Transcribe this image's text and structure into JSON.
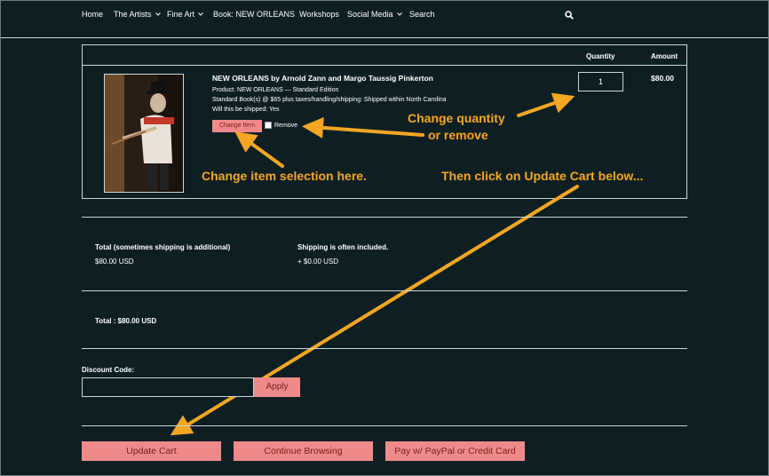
{
  "nav": {
    "home": "Home",
    "artists": "The Artists",
    "fine_art": "Fine Art",
    "book": "Book: NEW ORLEANS",
    "workshops": "Workshops",
    "social": "Social Media",
    "search": "Search"
  },
  "cart": {
    "col_quantity": "Quantity",
    "col_amount": "Amount",
    "product_title": "NEW ORLEANS by Arnold Zann and Margo Taussig Pinkerton",
    "product_line": "Product: NEW ORLEANS — Standard Edition",
    "product_detail": "Standard Book(s) @ $65 plus taxes/handling/shipping: Shipped within North Carolina",
    "shipped": "Will this be shipped: Yes",
    "change_item": "Change Item",
    "remove": "Remove",
    "quantity": "1",
    "amount": "$80.00"
  },
  "annotations": {
    "change_qty_1": "Change quantity",
    "change_qty_2": "or remove",
    "change_item": "Change item selection here.",
    "update_hint": "Then click on Update Cart below..."
  },
  "colors": {
    "accent": "#f5a623",
    "button": "#f08a8a",
    "background": "#0e1f24"
  },
  "totals": {
    "total_label": "Total (sometimes shipping is additional)",
    "total_value": "$80.00 USD",
    "shipping_label": "Shipping is often included.",
    "shipping_value": "+ $0.00 USD",
    "grand_total": "Total : $80.00 USD"
  },
  "discount": {
    "label": "Discount Code:",
    "apply": "Apply"
  },
  "buttons": {
    "update": "Update Cart",
    "continue": "Continue Browsing",
    "pay": "Pay w/ PayPal or Credit Card"
  }
}
